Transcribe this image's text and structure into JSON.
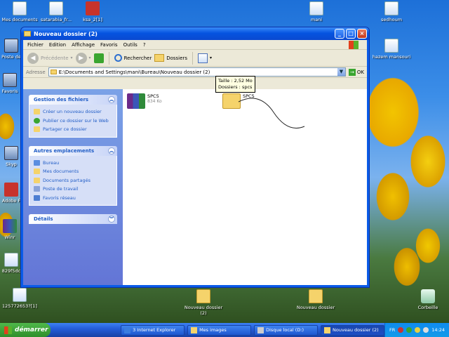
{
  "desktop": {
    "icons": [
      {
        "label": "Mes documents",
        "icon": "documents-icon"
      },
      {
        "label": "satarabia_fr...",
        "icon": "document-icon"
      },
      {
        "label": "ksa_2[1]",
        "icon": "document-icon"
      },
      {
        "label": "mani",
        "icon": "document-icon"
      },
      {
        "label": "sedhoum",
        "icon": "document-icon"
      },
      {
        "label": "Poste de",
        "icon": "computer-icon"
      },
      {
        "label": "hazem mansouri",
        "icon": "document-icon"
      },
      {
        "label": "Favoris",
        "icon": "ie-icon"
      },
      {
        "label": "Skyp",
        "icon": "skype-icon"
      },
      {
        "label": "Adobe F",
        "icon": "adobe-icon"
      },
      {
        "label": "Winr",
        "icon": "winrar-icon"
      },
      {
        "label": "829f5dc",
        "icon": "document-icon"
      },
      {
        "label": "125772653?[1]",
        "icon": "document-icon"
      },
      {
        "label": "Nouveau dossier (2)",
        "icon": "folder-icon"
      },
      {
        "label": "Nouveau dossier",
        "icon": "folder-icon"
      },
      {
        "label": "Corbeille",
        "icon": "recycle-bin-icon"
      }
    ]
  },
  "window": {
    "title": "Nouveau dossier (2)",
    "menu": [
      "Fichier",
      "Edition",
      "Affichage",
      "Favoris",
      "Outils",
      "?"
    ],
    "toolbar": {
      "back": "Précédente",
      "search": "Rechercher",
      "folders": "Dossiers"
    },
    "address": {
      "label": "Adresse",
      "value": "E:\\Documents and Settings\\mani\\Bureau\\Nouveau dossier (2)",
      "ok": "OK"
    },
    "tasks": {
      "file_tasks": {
        "title": "Gestion des fichiers",
        "items": [
          "Créer un nouveau dossier",
          "Publier ce dossier sur le Web",
          "Partager ce dossier"
        ]
      },
      "other_places": {
        "title": "Autres emplacements",
        "items": [
          "Bureau",
          "Mes documents",
          "Documents partagés",
          "Poste de travail",
          "Favoris réseau"
        ]
      },
      "details": {
        "title": "Détails"
      }
    },
    "files": [
      {
        "name": "SPC5",
        "size": "834 Ko",
        "type": "winrar-archive-icon"
      },
      {
        "name": "SPC5",
        "size": "",
        "type": "folder-icon"
      }
    ],
    "tooltip": {
      "line1": "Taille : 2,52 Mo",
      "line2": "Dossiers : spcs"
    }
  },
  "taskbar": {
    "start": "démarrer",
    "tasks": [
      {
        "label": "3 Internet Explorer",
        "active": false
      },
      {
        "label": "Mes images",
        "active": false
      },
      {
        "label": "Disque local (D:)",
        "active": false
      },
      {
        "label": "Nouveau dossier (2)",
        "active": true
      }
    ],
    "tray": {
      "lang": "FR",
      "time": "14:24"
    }
  }
}
